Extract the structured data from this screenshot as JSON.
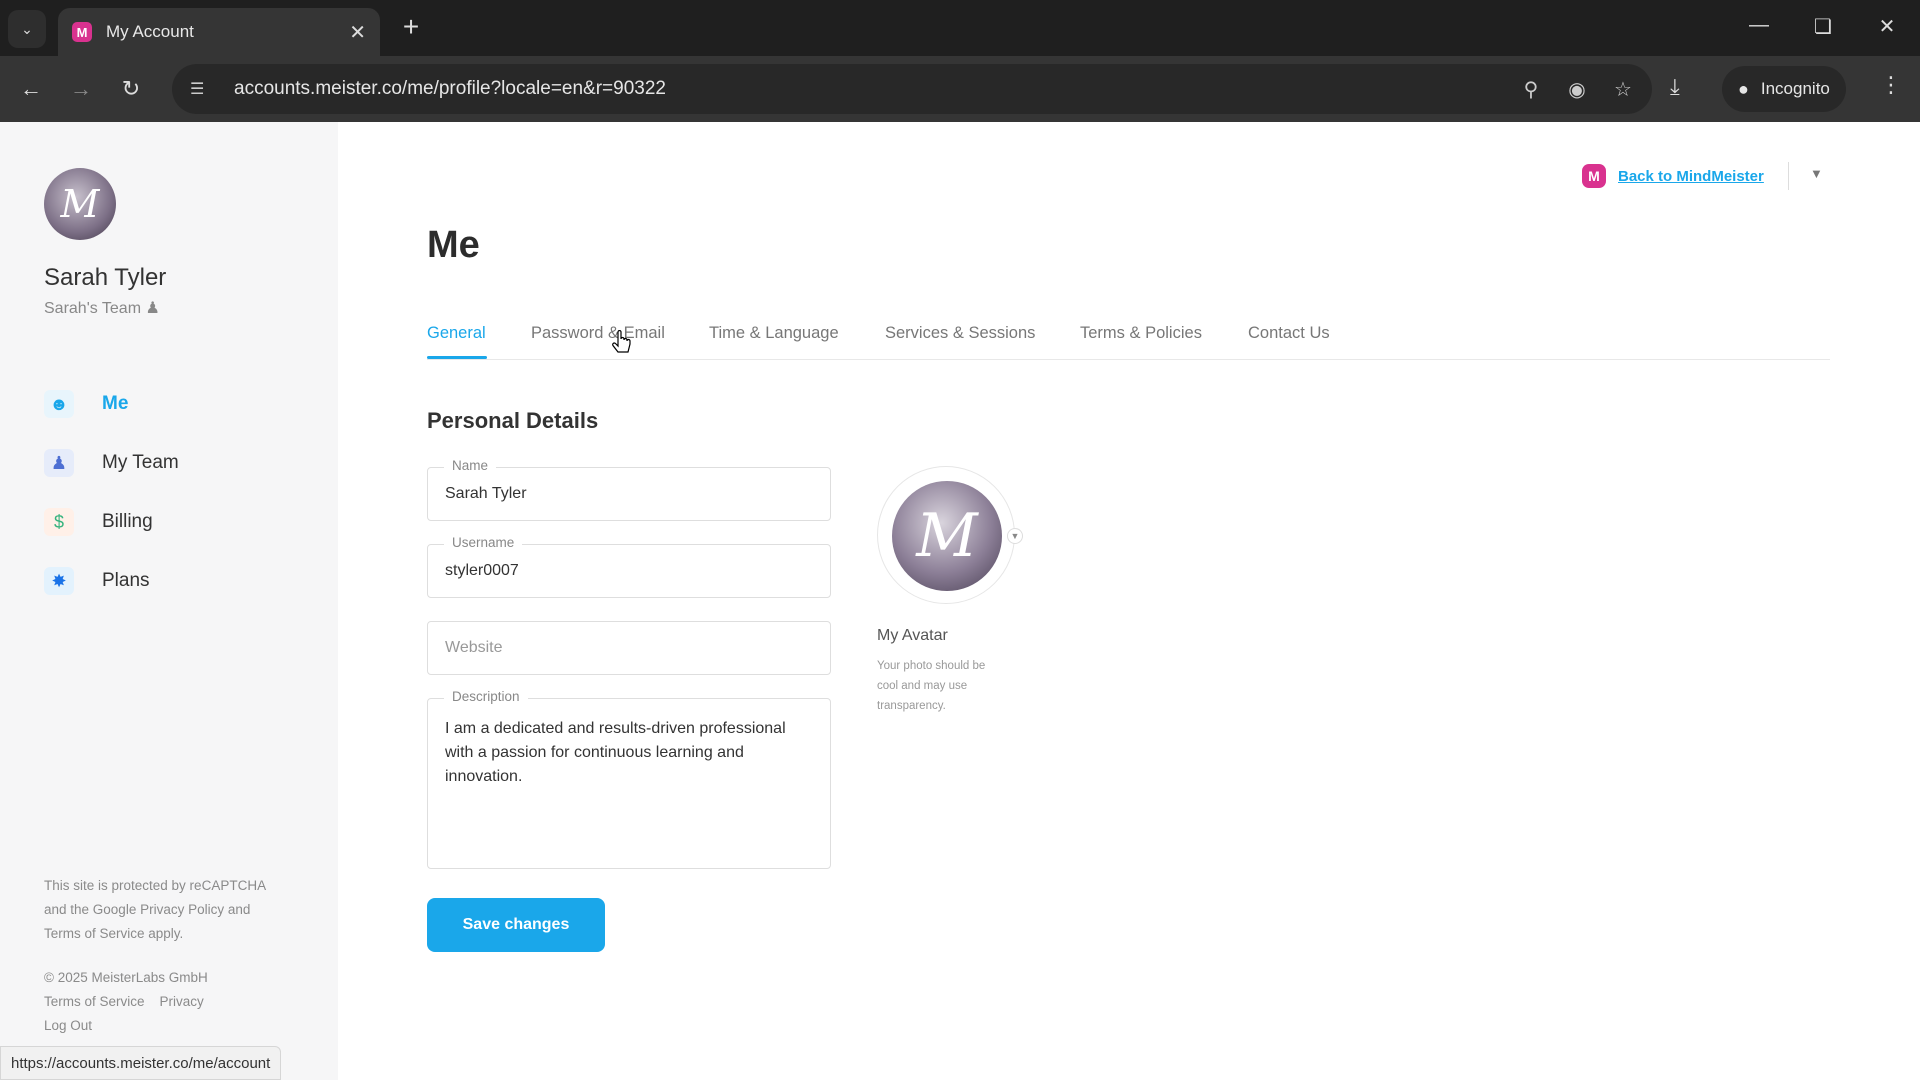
{
  "browser": {
    "tab_title": "My Account",
    "tab_favicon": "M",
    "url": "accounts.meister.co/me/profile?locale=en&r=90322",
    "incognito_label": "Incognito",
    "status_url": "https://accounts.meister.co/me/account"
  },
  "sidebar": {
    "user_name": "Sarah Tyler",
    "team_name": "Sarah's Team",
    "avatar_letter": "M",
    "items": [
      {
        "label": "Me",
        "icon": "profile-card-icon"
      },
      {
        "label": "My Team",
        "icon": "team-icon"
      },
      {
        "label": "Billing",
        "icon": "billing-icon"
      },
      {
        "label": "Plans",
        "icon": "plans-badge-icon"
      }
    ],
    "recaptcha_line1": "This site is protected by reCAPTCHA",
    "recaptcha_line2": "and the Google Privacy Policy and",
    "recaptcha_line3": "Terms of Service apply.",
    "copyright": "© 2025 MeisterLabs GmbH",
    "terms_link": "Terms of Service",
    "privacy_link": "Privacy",
    "logout_link": "Log Out"
  },
  "header": {
    "back_link": "Back to MindMeister",
    "logo_letter": "M"
  },
  "main": {
    "title": "Me",
    "tabs": [
      "General",
      "Password & Email",
      "Time & Language",
      "Services & Sessions",
      "Terms & Policies",
      "Contact Us"
    ],
    "section_title": "Personal Details",
    "name_label": "Name",
    "name_value": "Sarah Tyler",
    "username_label": "Username",
    "username_value": "styler0007",
    "website_placeholder": "Website",
    "description_label": "Description",
    "description_value": "I am a dedicated and results-driven professional with a passion for continuous learning and innovation.",
    "avatar_title": "My Avatar",
    "avatar_hint": "Your photo should be cool and may use transparency.",
    "save_button": "Save changes"
  }
}
